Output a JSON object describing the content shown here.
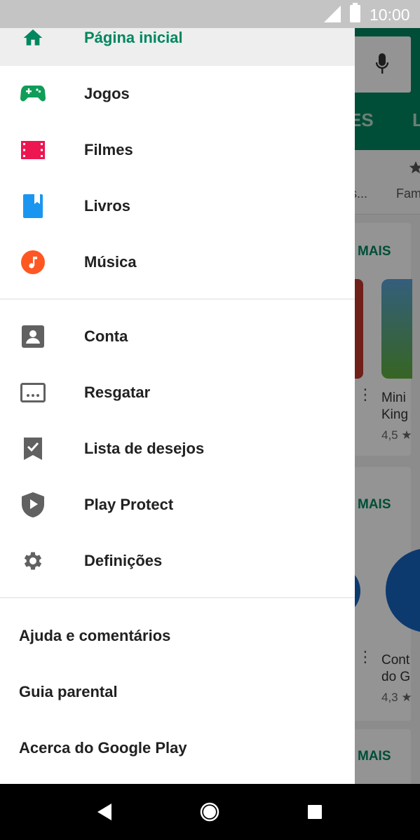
{
  "status_bar": {
    "time": "10:00"
  },
  "background": {
    "tab_partial_1": "ES",
    "tab_partial_2": "L",
    "chip_partial_1": "s...",
    "chip_partial_2": "Fam",
    "more_label": "MAIS",
    "card1_title_line1": "Mini",
    "card1_title_line2": "King",
    "card1_rating": "4,5 ★",
    "card2_title_line1": "Cont",
    "card2_title_line2": "do G",
    "card2_rating": "4,3 ★"
  },
  "drawer": {
    "primary_items": [
      {
        "label": "Página inicial",
        "icon": "home-icon",
        "color": "#01875f",
        "active": true
      },
      {
        "label": "Jogos",
        "icon": "gamepad-icon",
        "color": "#0f9d58"
      },
      {
        "label": "Filmes",
        "icon": "film-icon",
        "color": "#ed1651"
      },
      {
        "label": "Livros",
        "icon": "book-icon",
        "color": "#1a96f0"
      },
      {
        "label": "Música",
        "icon": "music-icon",
        "color": "#ff5722"
      }
    ],
    "account_items": [
      {
        "label": "Conta",
        "icon": "account-icon"
      },
      {
        "label": "Resgatar",
        "icon": "redeem-icon"
      },
      {
        "label": "Lista de desejos",
        "icon": "wishlist-icon"
      },
      {
        "label": "Play Protect",
        "icon": "shield-play-icon"
      },
      {
        "label": "Definições",
        "icon": "gear-icon"
      }
    ],
    "footer_items": [
      {
        "label": "Ajuda e comentários"
      },
      {
        "label": "Guia parental"
      },
      {
        "label": "Acerca do Google Play"
      }
    ]
  },
  "colors": {
    "accent": "#01875f",
    "icon_grey": "#616161"
  }
}
